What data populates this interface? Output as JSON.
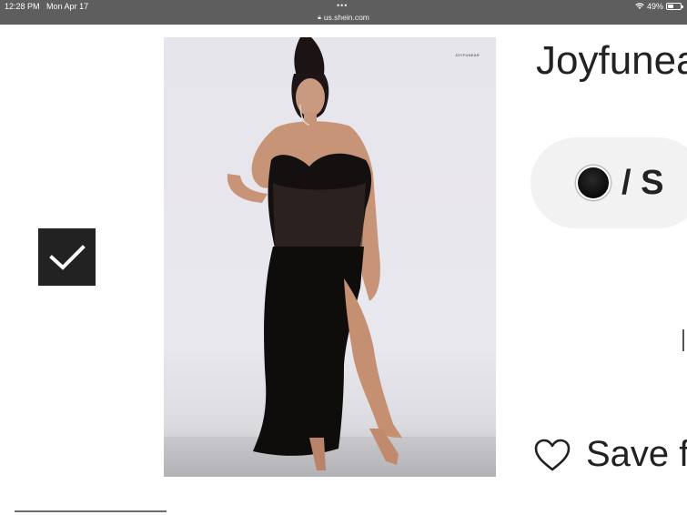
{
  "status_bar": {
    "time": "12:28 PM",
    "date": "Mon Apr 17",
    "url": "us.shein.com",
    "battery": "49%",
    "battery_level": 0.49,
    "icons": [
      "lock-icon",
      "wifi-icon",
      "battery-icon"
    ]
  },
  "product": {
    "image_brand": "JOYFUNEAR",
    "title": "Joyfunea",
    "variant_size": "/ S",
    "swatch_color": "#111111",
    "save_label": "Save f"
  },
  "colors": {
    "status_bar_bg": "#5e5e5e",
    "check_box_bg": "#222222",
    "pill_bg": "#f2f2f2"
  }
}
